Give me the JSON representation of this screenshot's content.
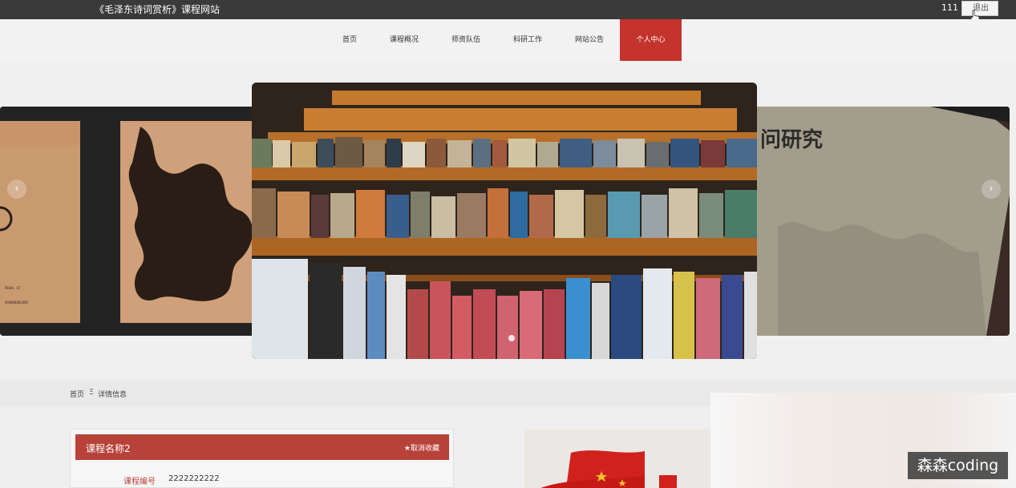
{
  "header": {
    "site_title": "《毛泽东诗词赏析》课程网站",
    "username": "111",
    "logout_label": "退出"
  },
  "nav": {
    "items": [
      {
        "label": "首页"
      },
      {
        "label": "课程概况"
      },
      {
        "label": "师资队伍"
      },
      {
        "label": "科研工作"
      },
      {
        "label": "网站公告"
      },
      {
        "label": "个人中心"
      }
    ],
    "active_index": 5
  },
  "banner": {
    "prev_arrow": "‹",
    "next_arrow": "›",
    "slide_count": 3,
    "active_slide": 1,
    "right_slide_text": "问研究"
  },
  "breadcrumb": {
    "home": "首页",
    "separator": "Ξ",
    "current": "详情信息"
  },
  "detail": {
    "title": "课程名称2",
    "favorite_label": "★取消收藏",
    "fields": [
      {
        "label": "课程编号",
        "value": "2222222222"
      }
    ]
  },
  "watermark": "森森coding",
  "colors": {
    "accent": "#c4332c",
    "card_header": "#b8423a",
    "topbar": "#3a3a3a"
  }
}
